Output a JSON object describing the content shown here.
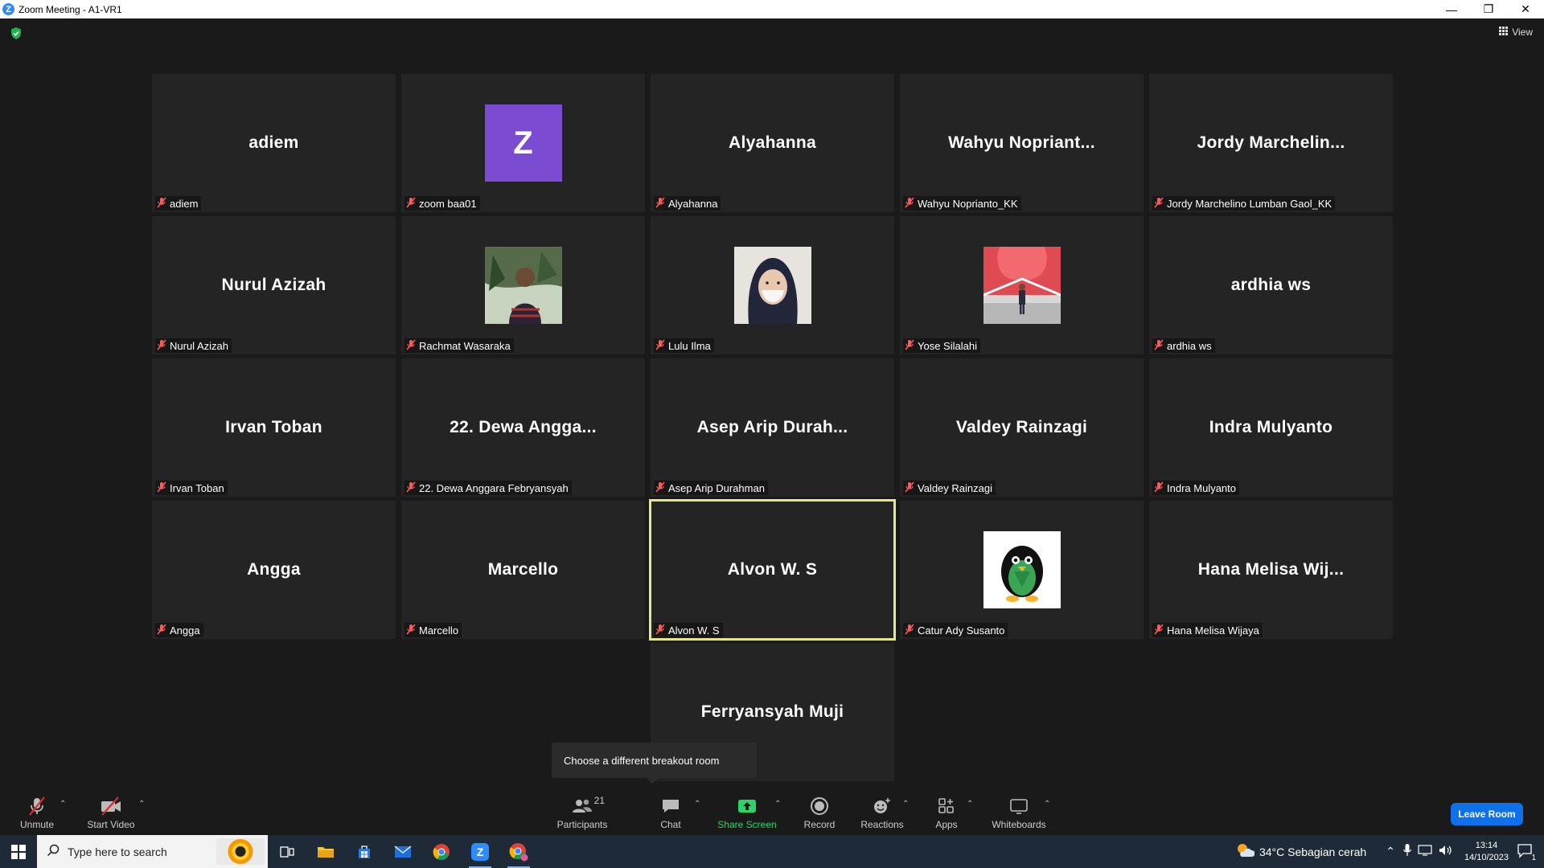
{
  "window": {
    "title": "Zoom Meeting - A1-VR1",
    "logo_letter": "Z"
  },
  "meeting": {
    "view_label": "View",
    "tiles": [
      {
        "center": "adiem",
        "label": "adiem",
        "type": "name"
      },
      {
        "center": "Z",
        "label": "zoom baa01",
        "type": "letter",
        "avatar_color": "#7b4bd1"
      },
      {
        "center": "Alyahanna",
        "label": "Alyahanna",
        "type": "name"
      },
      {
        "center": "Wahyu  Nopriant...",
        "label": "Wahyu Noprianto_KK",
        "type": "name"
      },
      {
        "center": "Jordy  Marchelin...",
        "label": "Jordy Marchelino Lumban Gaol_KK",
        "type": "name"
      },
      {
        "center": "Nurul Azizah",
        "label": "Nurul Azizah",
        "type": "name"
      },
      {
        "center": "",
        "label": "Rachmat Wasaraka",
        "type": "photo-man"
      },
      {
        "center": "",
        "label": "Lulu Ilma",
        "type": "photo-hijab"
      },
      {
        "center": "",
        "label": "Yose Silalahi",
        "type": "photo-red"
      },
      {
        "center": "ardhia ws",
        "label": "ardhia ws",
        "type": "name"
      },
      {
        "center": "Irvan Toban",
        "label": "Irvan Toban",
        "type": "name"
      },
      {
        "center": "22. Dewa Angga...",
        "label": "22. Dewa Anggara Febryansyah",
        "type": "name"
      },
      {
        "center": "Asep  Arip  Durah...",
        "label": "Asep Arip Durahman",
        "type": "name"
      },
      {
        "center": "Valdey Rainzagi",
        "label": "Valdey Rainzagi",
        "type": "name"
      },
      {
        "center": "Indra Mulyanto",
        "label": "Indra Mulyanto",
        "type": "name"
      },
      {
        "center": "Angga",
        "label": "Angga",
        "type": "name"
      },
      {
        "center": "Marcello",
        "label": "Marcello",
        "type": "name"
      },
      {
        "center": "Alvon W. S",
        "label": "Alvon W. S",
        "type": "name",
        "active": true
      },
      {
        "center": "",
        "label": "Catur Ady Susanto",
        "type": "photo-penguin"
      },
      {
        "center": "Hana  Melisa  Wij...",
        "label": "Hana Melisa Wijaya",
        "type": "name"
      },
      {
        "center": "Ferryansyah Muji",
        "label": "",
        "type": "name"
      }
    ],
    "tooltip": "Choose a different breakout room"
  },
  "toolbar": {
    "unmute": "Unmute",
    "start_video": "Start Video",
    "participants": "Participants",
    "participants_count": "21",
    "chat": "Chat",
    "share_screen": "Share Screen",
    "record": "Record",
    "reactions": "Reactions",
    "apps": "Apps",
    "whiteboards": "Whiteboards",
    "leave": "Leave Room",
    "accent_green": "#2cd46a",
    "leave_color": "#0e71eb"
  },
  "taskbar": {
    "search_placeholder": "Type here to search",
    "weather": "34°C  Sebagian cerah",
    "time": "13:14",
    "date": "14/10/2023",
    "notification_count": "1"
  }
}
